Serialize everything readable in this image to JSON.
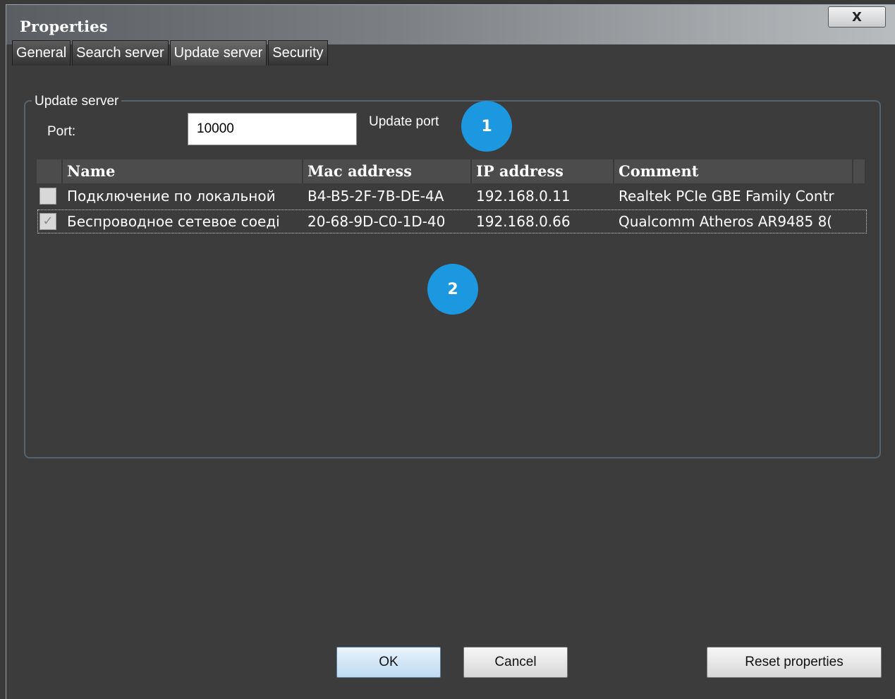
{
  "window": {
    "title": "Properties",
    "close_label": "X"
  },
  "tabs": [
    {
      "label": "General"
    },
    {
      "label": "Search server"
    },
    {
      "label": "Update server",
      "active": true
    },
    {
      "label": "Security"
    }
  ],
  "group": {
    "legend": "Update server",
    "port_label": "Port:",
    "port_value": "10000",
    "port_hint": "Update port"
  },
  "badges": [
    "1",
    "2"
  ],
  "table": {
    "columns": [
      "Name",
      "Mac address",
      "IP address",
      "Comment"
    ],
    "rows": [
      {
        "checked": false,
        "name": "Подключение по локальной",
        "mac": "B4-B5-2F-7B-DE-4A",
        "ip": "192.168.0.11",
        "comment": "Realtek PCIe GBE Family Contr"
      },
      {
        "checked": true,
        "name": "Беспроводное сетевое соеді",
        "mac": "20-68-9D-C0-1D-40",
        "ip": "192.168.0.66",
        "comment": "Qualcomm Atheros AR9485 8("
      }
    ]
  },
  "buttons": {
    "ok": "OK",
    "cancel": "Cancel",
    "reset": "Reset properties"
  },
  "colors": {
    "background": "#3c3c3c",
    "badge": "#1b98e0",
    "group_border": "#566470"
  }
}
